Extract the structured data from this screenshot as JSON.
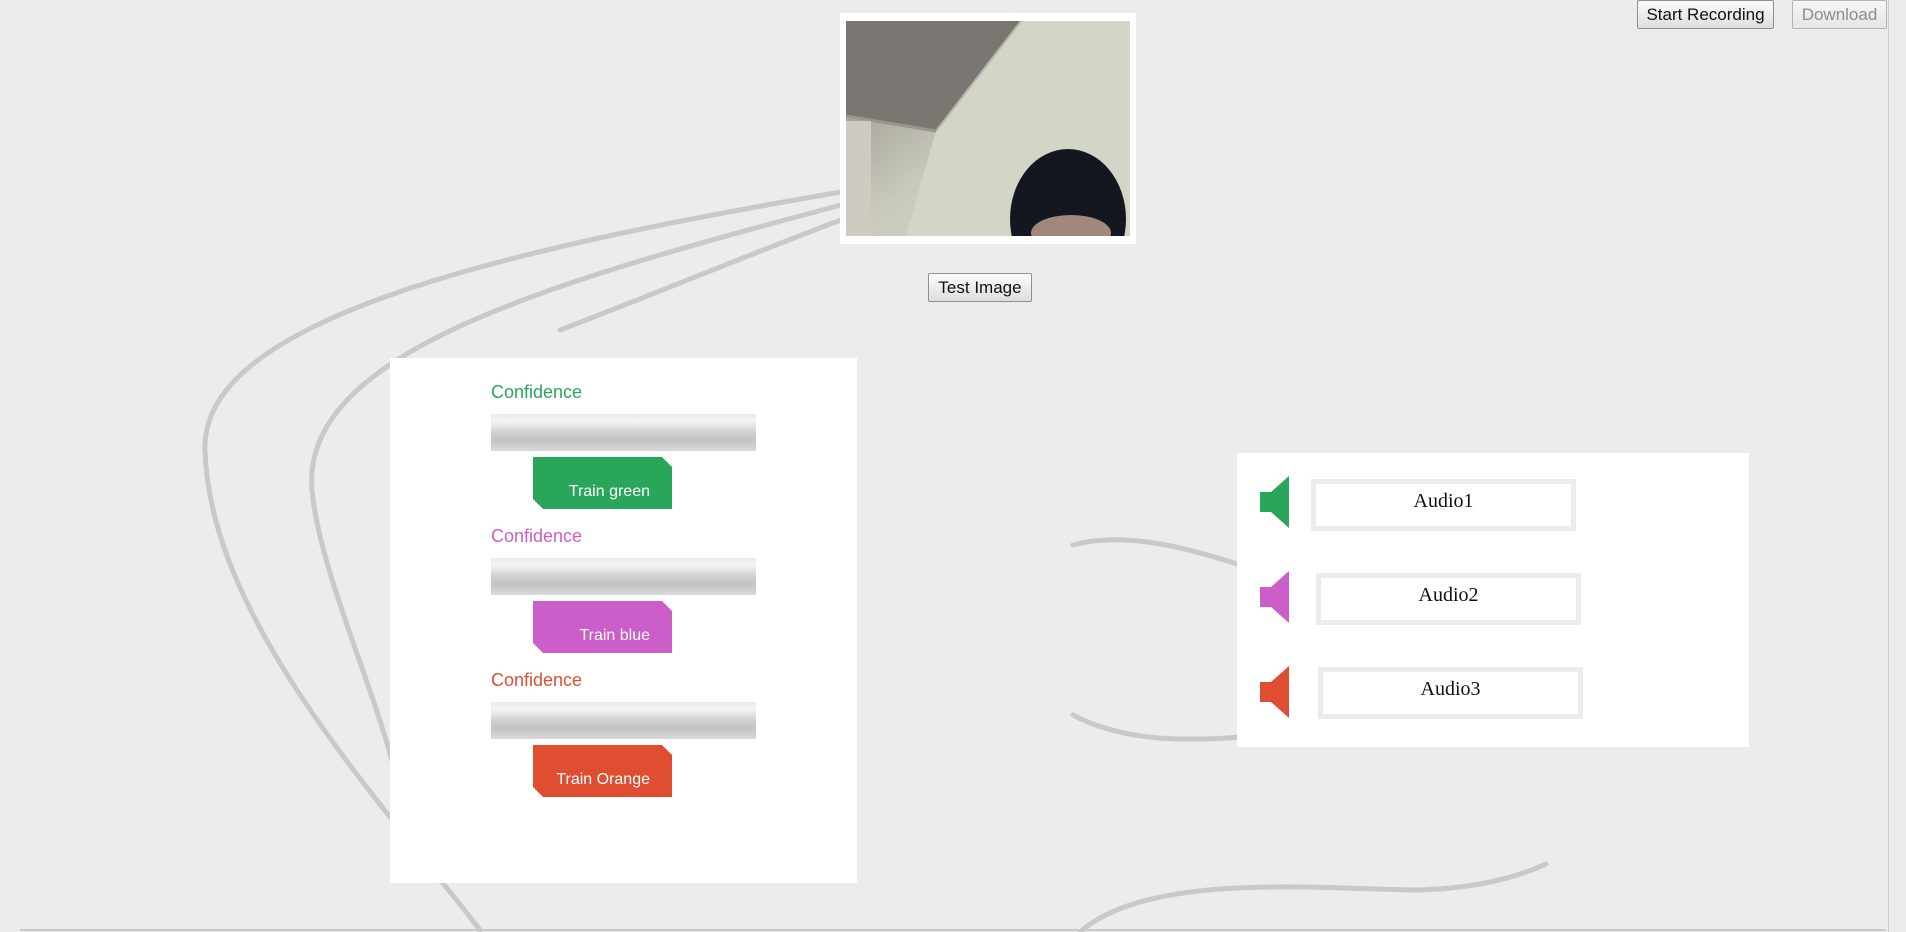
{
  "toolbar": {
    "start_recording_label": "Start Recording",
    "download_label": "Download"
  },
  "webcam": {
    "test_image_label": "Test Image"
  },
  "trainer": {
    "items": [
      {
        "confidence_label": "Confidence",
        "train_label": "Train green",
        "color": "#2aa65a"
      },
      {
        "confidence_label": "Confidence",
        "train_label": "Train blue",
        "color": "#cc5ec9"
      },
      {
        "confidence_label": "Confidence",
        "train_label": "Train Orange",
        "color": "#e04e32"
      }
    ]
  },
  "audio": {
    "items": [
      {
        "label": "Audio1",
        "icon": "speaker-icon",
        "color": "#2aa65a"
      },
      {
        "label": "Audio2",
        "icon": "speaker-icon",
        "color": "#cc5ec9"
      },
      {
        "label": "Audio3",
        "icon": "speaker-icon",
        "color": "#e04e32"
      }
    ]
  }
}
